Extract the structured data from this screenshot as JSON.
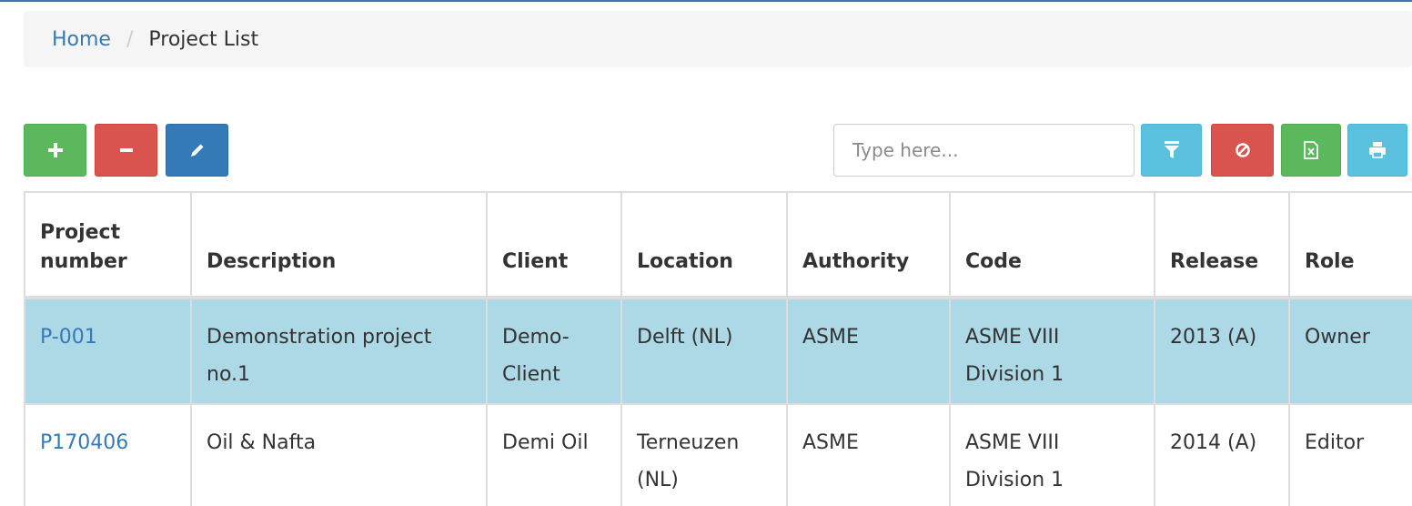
{
  "breadcrumb": {
    "home": "Home",
    "separator": "/",
    "current": "Project List"
  },
  "search": {
    "placeholder": "Type here...",
    "value": ""
  },
  "toolbar": {
    "left_icons": [
      "plus-icon",
      "minus-icon",
      "pencil-icon"
    ],
    "right_icons": [
      "filter-icon",
      "ban-icon",
      "excel-icon",
      "print-icon"
    ]
  },
  "colors": {
    "primary": "#337ab7",
    "success": "#5cb85c",
    "danger": "#d9534f",
    "info": "#5bc0de",
    "selected_row": "#add8e6",
    "link": "#337ab7"
  },
  "table": {
    "headers": [
      "Project number",
      "Description",
      "Client",
      "Location",
      "Authority",
      "Code",
      "Release",
      "Role"
    ],
    "rows": [
      {
        "project_number": "P-001",
        "description": "Demonstration project no.1",
        "client": "Demo-Client",
        "location": "Delft (NL)",
        "authority": "ASME",
        "code": "ASME VIII Division 1",
        "release": "2013 (A)",
        "role": "Owner"
      },
      {
        "project_number": "P170406",
        "description": "Oil & Nafta",
        "client": "Demi Oil",
        "location": "Terneuzen (NL)",
        "authority": "ASME",
        "code": "ASME VIII Division 1",
        "release": "2014 (A)",
        "role": "Editor"
      }
    ]
  }
}
